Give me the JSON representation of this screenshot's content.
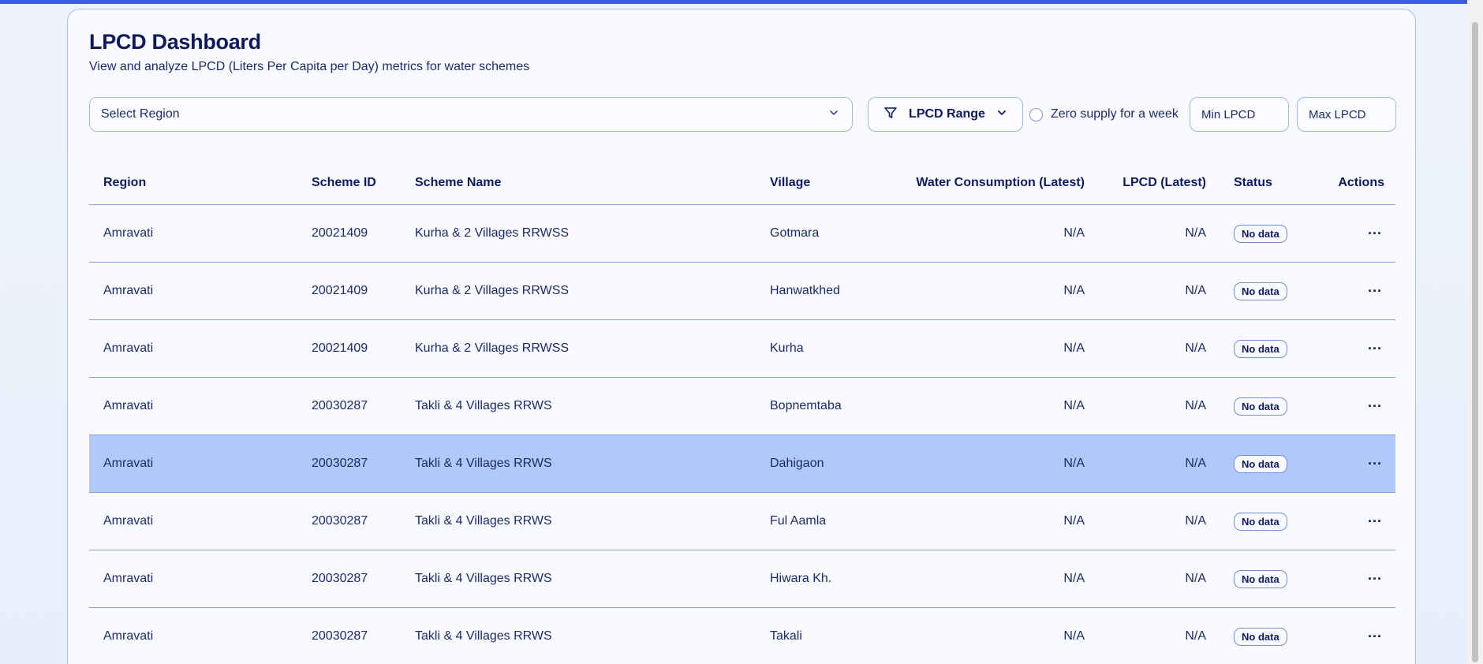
{
  "header": {
    "title": "LPCD Dashboard",
    "subtitle": "View and analyze LPCD (Liters Per Capita per Day) metrics for water schemes"
  },
  "filters": {
    "region_placeholder": "Select Region",
    "range_label": "LPCD Range",
    "zero_supply_label": "Zero supply for a week",
    "zero_supply_checked": false,
    "min_placeholder": "Min LPCD",
    "max_placeholder": "Max LPCD"
  },
  "table": {
    "columns": {
      "region": "Region",
      "scheme_id": "Scheme ID",
      "scheme_name": "Scheme Name",
      "village": "Village",
      "water": "Water Consumption (Latest)",
      "lpcd": "LPCD (Latest)",
      "status": "Status",
      "actions": "Actions"
    },
    "rows": [
      {
        "region": "Amravati",
        "scheme_id": "20021409",
        "scheme_name": "Kurha & 2 Villages RRWSS",
        "village": "Gotmara",
        "water": "N/A",
        "lpcd": "N/A",
        "status": "No data",
        "actions": "···"
      },
      {
        "region": "Amravati",
        "scheme_id": "20021409",
        "scheme_name": "Kurha & 2 Villages RRWSS",
        "village": "Hanwatkhed",
        "water": "N/A",
        "lpcd": "N/A",
        "status": "No data",
        "actions": "···"
      },
      {
        "region": "Amravati",
        "scheme_id": "20021409",
        "scheme_name": "Kurha & 2 Villages RRWSS",
        "village": "Kurha",
        "water": "N/A",
        "lpcd": "N/A",
        "status": "No data",
        "actions": "···"
      },
      {
        "region": "Amravati",
        "scheme_id": "20030287",
        "scheme_name": "Takli & 4 Villages RRWS",
        "village": "Bopnemtaba",
        "water": "N/A",
        "lpcd": "N/A",
        "status": "No data",
        "actions": "···"
      },
      {
        "region": "Amravati",
        "scheme_id": "20030287",
        "scheme_name": "Takli & 4 Villages RRWS",
        "village": "Dahigaon",
        "water": "N/A",
        "lpcd": "N/A",
        "status": "No data",
        "actions": "···"
      },
      {
        "region": "Amravati",
        "scheme_id": "20030287",
        "scheme_name": "Takli & 4 Villages RRWS",
        "village": "Ful Aamla",
        "water": "N/A",
        "lpcd": "N/A",
        "status": "No data",
        "actions": "···"
      },
      {
        "region": "Amravati",
        "scheme_id": "20030287",
        "scheme_name": "Takli & 4 Villages RRWS",
        "village": "Hiwara Kh.",
        "water": "N/A",
        "lpcd": "N/A",
        "status": "No data",
        "actions": "···"
      },
      {
        "region": "Amravati",
        "scheme_id": "20030287",
        "scheme_name": "Takli & 4 Villages RRWS",
        "village": "Takali",
        "water": "N/A",
        "lpcd": "N/A",
        "status": "No data",
        "actions": "···"
      }
    ],
    "selected_row": 4
  },
  "colors": {
    "accent": "#3f5fd8",
    "selected_row": "#b0c9f8",
    "border": "#7ea0e6"
  }
}
